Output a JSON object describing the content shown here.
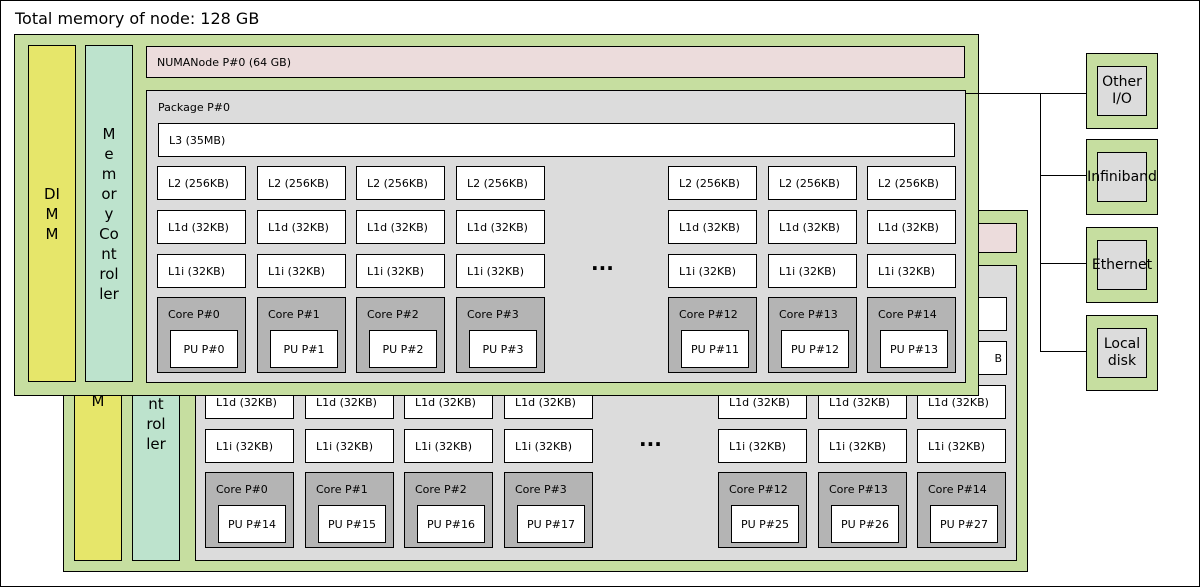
{
  "title": "Total memory of node: 128 GB",
  "colors": {
    "node_bg": "#c6dea0",
    "dimm_bg": "#e6e66a",
    "memory_controller_bg": "#bde3cd",
    "numa_bg": "#ecdcdc",
    "package_bg": "#dcdcdc",
    "cache_bg": "#ffffff",
    "core_bg": "#b4b4b4"
  },
  "front_node": {
    "dimm_label": "DIMM",
    "memory_controller_label": "Memory Controller",
    "numa_label": "NUMANode P#0 (64 GB)",
    "package_label": "Package P#0",
    "l3_label": "L3 (35MB)",
    "ellipsis": "...",
    "columns": [
      {
        "l2": "L2 (256KB)",
        "l1d": "L1d (32KB)",
        "l1i": "L1i (32KB)",
        "core": "Core P#0",
        "pu": "PU P#0"
      },
      {
        "l2": "L2 (256KB)",
        "l1d": "L1d (32KB)",
        "l1i": "L1i (32KB)",
        "core": "Core P#1",
        "pu": "PU P#1"
      },
      {
        "l2": "L2 (256KB)",
        "l1d": "L1d (32KB)",
        "l1i": "L1i (32KB)",
        "core": "Core P#2",
        "pu": "PU P#2"
      },
      {
        "l2": "L2 (256KB)",
        "l1d": "L1d (32KB)",
        "l1i": "L1i (32KB)",
        "core": "Core P#3",
        "pu": "PU P#3"
      },
      {
        "l2": "L2 (256KB)",
        "l1d": "L1d (32KB)",
        "l1i": "L1i (32KB)",
        "core": "Core P#12",
        "pu": "PU P#11"
      },
      {
        "l2": "L2 (256KB)",
        "l1d": "L1d (32KB)",
        "l1i": "L1i (32KB)",
        "core": "Core P#13",
        "pu": "PU P#12"
      },
      {
        "l2": "L2 (256KB)",
        "l1d": "L1d (32KB)",
        "l1i": "L1i (32KB)",
        "core": "Core P#14",
        "pu": "PU P#13"
      }
    ]
  },
  "back_node": {
    "dimm_label": "M",
    "memory_controller_label": "ntroller",
    "ellipsis": "...",
    "partial_right_label": "B",
    "columns": [
      {
        "l1d": "L1d (32KB)",
        "l1i": "L1i (32KB)",
        "core": "Core P#0",
        "pu": "PU P#14"
      },
      {
        "l1d": "L1d (32KB)",
        "l1i": "L1i (32KB)",
        "core": "Core P#1",
        "pu": "PU P#15"
      },
      {
        "l1d": "L1d (32KB)",
        "l1i": "L1i (32KB)",
        "core": "Core P#2",
        "pu": "PU P#16"
      },
      {
        "l1d": "L1d (32KB)",
        "l1i": "L1i (32KB)",
        "core": "Core P#3",
        "pu": "PU P#17"
      },
      {
        "l1d": "L1d (32KB)",
        "l1i": "L1i (32KB)",
        "core": "Core P#12",
        "pu": "PU P#25"
      },
      {
        "l1d": "L1d (32KB)",
        "l1i": "L1i (32KB)",
        "core": "Core P#13",
        "pu": "PU P#26"
      },
      {
        "l1d": "L1d (32KB)",
        "l1i": "L1i (32KB)",
        "core": "Core P#14",
        "pu": "PU P#27"
      }
    ]
  },
  "io_devices": [
    {
      "label": "Other I/O"
    },
    {
      "label": "Infiniband"
    },
    {
      "label": "Ethernet"
    },
    {
      "label": "Local disk"
    }
  ]
}
